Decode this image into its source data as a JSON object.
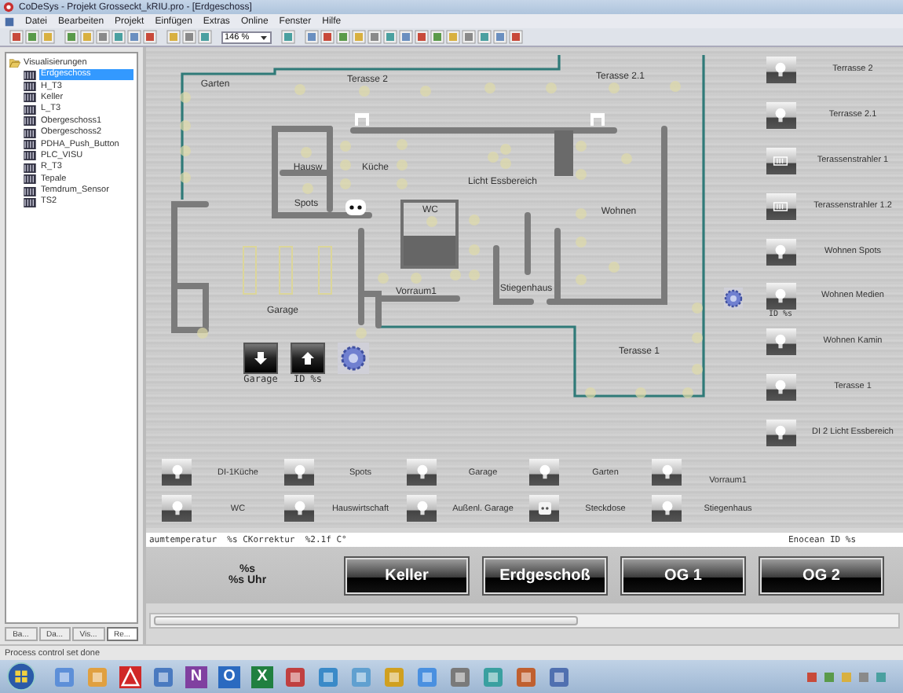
{
  "window": {
    "title": "CoDeSys - Projekt Grosseckt_kRIU.pro - [Erdgeschoss]"
  },
  "menu": [
    "Datei",
    "Bearbeiten",
    "Projekt",
    "Einfügen",
    "Extras",
    "Online",
    "Fenster",
    "Hilfe"
  ],
  "toolbar": {
    "zoom": "146 %"
  },
  "tree": {
    "label": "Visualisierungen",
    "expanded": true,
    "children": [
      {
        "label": "Erdgeschoss",
        "selected": true
      },
      {
        "label": "H_T3",
        "selected": false
      },
      {
        "label": "Keller",
        "selected": false
      },
      {
        "label": "L_T3",
        "selected": false
      },
      {
        "label": "Obergeschoss1",
        "selected": false
      },
      {
        "label": "Obergeschoss2",
        "selected": false
      },
      {
        "label": "PDHA_Push_Button",
        "selected": false
      },
      {
        "label": "PLC_VISU",
        "selected": false
      },
      {
        "label": "R_T3",
        "selected": false
      },
      {
        "label": "Tepale",
        "selected": false
      },
      {
        "label": "Temdrum_Sensor",
        "selected": false
      },
      {
        "label": "TS2",
        "selected": false
      }
    ]
  },
  "panel_tabs": [
    {
      "label": "Ba...",
      "selected": false
    },
    {
      "label": "Da...",
      "selected": false
    },
    {
      "label": "Vis...",
      "selected": false
    },
    {
      "label": "Re...",
      "selected": true
    }
  ],
  "plan": {
    "rooms": [
      "Garten",
      "Terasse 2",
      "Terasse 2.1",
      "Hausw",
      "Küche",
      "Licht Essbereich",
      "Spots",
      "WC",
      "Wohnen",
      "Vorraum1",
      "Stiegenhaus",
      "Garage",
      "Terasse 1"
    ],
    "buttons": [
      {
        "kind": "down",
        "caption": "Garage"
      },
      {
        "kind": "up",
        "caption": "ID %s"
      }
    ]
  },
  "right_lamps": [
    {
      "kind": "lamp",
      "label": "Terrasse 2"
    },
    {
      "kind": "lamp",
      "label": "Terrasse 2.1"
    },
    {
      "kind": "heater",
      "label": "Terassenstrahler 1"
    },
    {
      "kind": "heater",
      "label": "Terassenstrahler 1.2"
    },
    {
      "kind": "lamp",
      "label": "Wohnen Spots"
    },
    {
      "kind": "lamp",
      "label": "Wohnen Medien",
      "caption": "ID %s"
    },
    {
      "kind": "lamp",
      "label": "Wohnen Kamin"
    },
    {
      "kind": "lamp",
      "label": "Terasse 1"
    },
    {
      "kind": "lamp",
      "label": "DI 2 Licht Essbereich"
    }
  ],
  "lamp_rows": [
    [
      {
        "kind": "lamp",
        "label": "DI-1Küche"
      },
      {
        "kind": "lamp",
        "label": "Spots"
      },
      {
        "kind": "lamp",
        "label": "Garage"
      },
      {
        "kind": "lamp",
        "label": "Garten"
      },
      {
        "kind": "lamp",
        "label": "Vorraum1"
      }
    ],
    [
      {
        "kind": "lamp",
        "label": "WC"
      },
      {
        "kind": "lamp",
        "label": "Hauswirtschaft"
      },
      {
        "kind": "lamp",
        "label": "Außenl. Garage"
      },
      {
        "kind": "socket",
        "label": "Steckdose"
      },
      {
        "kind": "lamp",
        "label": "Stiegenhaus"
      }
    ]
  ],
  "info_strip": {
    "left": "aumtemperatur  %s CKorrektur  %2.1f C°",
    "right": "Enocean ID %s"
  },
  "clock": [
    "%s",
    "%s Uhr"
  ],
  "floors": [
    {
      "label": "Keller"
    },
    {
      "label": "Erdgeschoß"
    },
    {
      "label": "OG 1"
    },
    {
      "label": "OG 2"
    }
  ],
  "status_bar": "Process control set done",
  "taskbar": {
    "apps": [
      {
        "kind": "plain"
      },
      {
        "kind": "plain"
      },
      {
        "kind": "warning"
      },
      {
        "kind": "plain"
      },
      {
        "kind": "letter",
        "glyph": "N"
      },
      {
        "kind": "letter",
        "glyph": "O"
      },
      {
        "kind": "letter",
        "glyph": "X"
      },
      {
        "kind": "plain"
      },
      {
        "kind": "plain"
      },
      {
        "kind": "plain"
      },
      {
        "kind": "plain"
      },
      {
        "kind": "plain"
      },
      {
        "kind": "plain"
      },
      {
        "kind": "plain"
      },
      {
        "kind": "plain"
      },
      {
        "kind": "plain"
      }
    ]
  }
}
